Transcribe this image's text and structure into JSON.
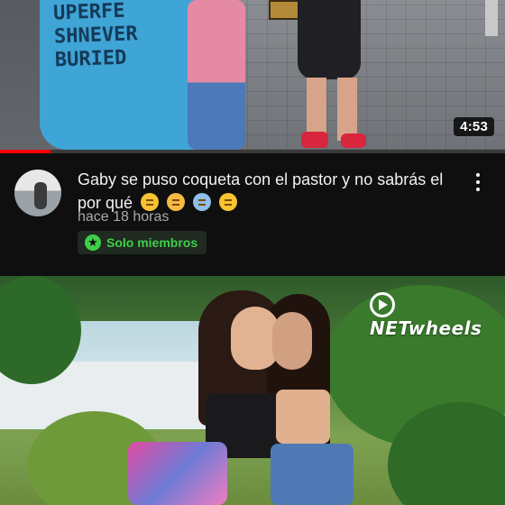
{
  "video1": {
    "duration": "4:53",
    "progress_fraction": 0.1,
    "shirt_print": "UPERFE\nSHNEVER\nBURIED",
    "title": "Gaby se puso coqueta con el pastor y no sabrás el por qué",
    "emojis": [
      "face-with-hand-over-mouth",
      "face-screaming-in-fear",
      "anxious-face-with-sweat",
      "face-with-hand-over-mouth"
    ],
    "age": "hace 18 horas",
    "badge_label": "Solo miembros",
    "badge_icon": "star-icon",
    "menu_icon": "kebab-menu-icon"
  },
  "video2": {
    "logo_text": "NETwheels"
  },
  "colors": {
    "background": "#0f0f0f",
    "progress": "#ff0000",
    "badge_text": "#3fcf4a",
    "text_primary": "#f1f1f1",
    "text_secondary": "#aaaaaa"
  }
}
